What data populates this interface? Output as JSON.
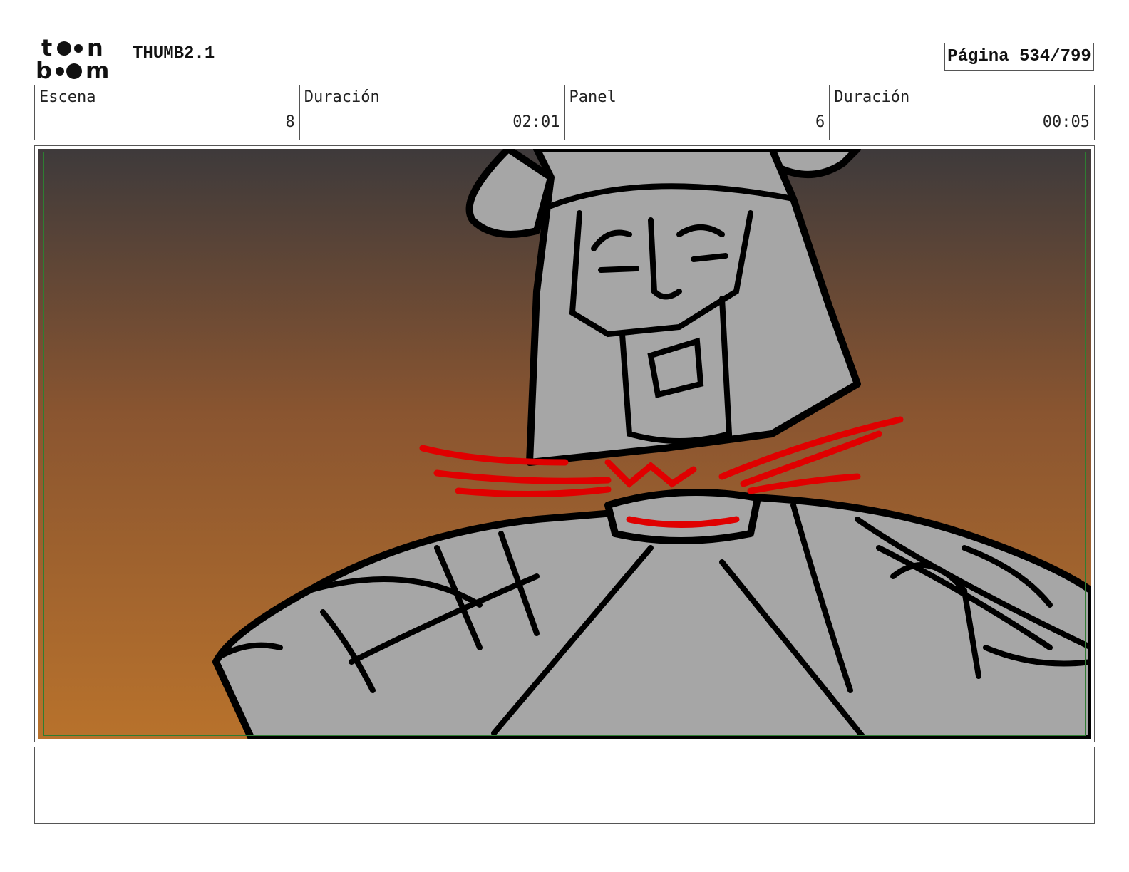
{
  "header": {
    "logo_text": "toon boom",
    "title": "THUMB2.1",
    "page_label": "Página 534/799"
  },
  "info": {
    "cells": [
      {
        "label": "Escena",
        "value": "8"
      },
      {
        "label": "Duración",
        "value": "02:01"
      },
      {
        "label": "Panel",
        "value": "6"
      },
      {
        "label": "Duración",
        "value": "00:05"
      }
    ]
  },
  "colors": {
    "sky_top": "#3e3a3b",
    "sky_bottom": "#b8722c",
    "armor_fill": "#a6a6a6",
    "ink": "#000000",
    "blood": "#e00000",
    "safe_area": "#2e7d32"
  },
  "notes": {
    "text": ""
  }
}
